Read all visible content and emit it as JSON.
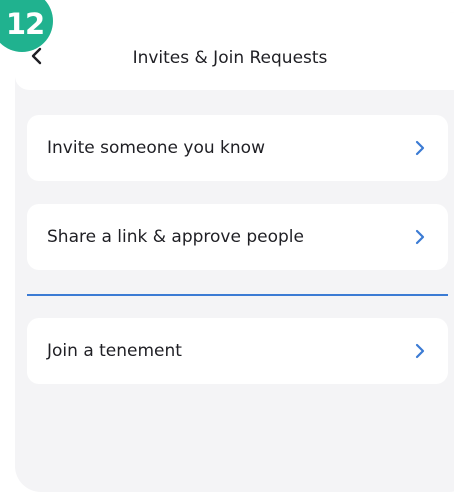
{
  "step_badge": "12",
  "header": {
    "title": "Invites & Join Requests",
    "back_icon": "chevron-left-icon"
  },
  "options": [
    {
      "label": "Invite someone you know",
      "icon": "chevron-right-icon"
    },
    {
      "label": "Share a link & approve people",
      "icon": "chevron-right-icon"
    },
    {
      "label": "Join a tenement",
      "icon": "chevron-right-icon"
    }
  ],
  "colors": {
    "accent_blue": "#3b7bd4",
    "badge_green": "#20b28f",
    "background": "#f4f4f6",
    "card": "#ffffff"
  }
}
